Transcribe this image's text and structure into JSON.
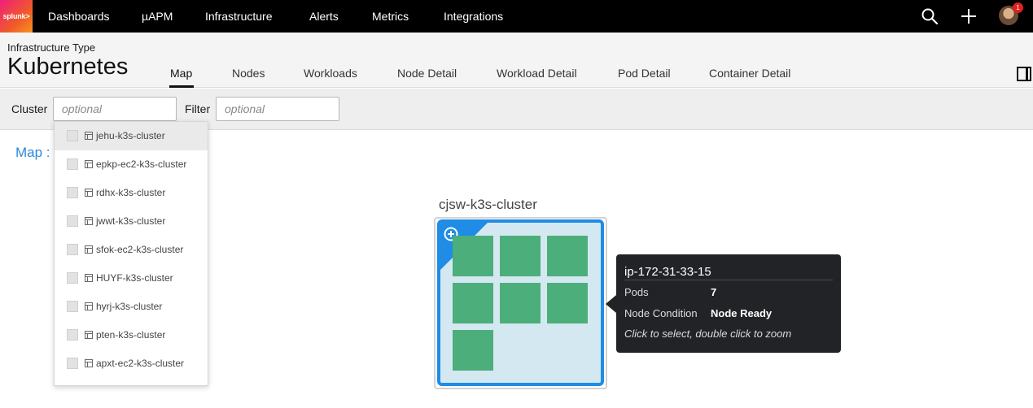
{
  "nav": {
    "logo": "splunk>",
    "items": [
      {
        "label": "Dashboards"
      },
      {
        "label": "µAPM"
      },
      {
        "label": "Infrastructure"
      },
      {
        "label": "Alerts"
      },
      {
        "label": "Metrics"
      },
      {
        "label": "Integrations"
      }
    ],
    "icons": [
      "search-icon",
      "plus-icon",
      "avatar"
    ],
    "notification_count": "1",
    "badge_color": "#e0201c"
  },
  "header": {
    "infra_type_label": "Infrastructure Type",
    "title": "Kubernetes",
    "tabs": [
      {
        "label": "Map",
        "active": true
      },
      {
        "label": "Nodes"
      },
      {
        "label": "Workloads"
      },
      {
        "label": "Node Detail"
      },
      {
        "label": "Workload Detail"
      },
      {
        "label": "Pod Detail"
      },
      {
        "label": "Container Detail"
      }
    ]
  },
  "filters": {
    "cluster_label": "Cluster",
    "cluster_placeholder": "optional",
    "filter_label": "Filter",
    "filter_placeholder": "optional"
  },
  "map": {
    "breadcrumb": "Map :",
    "cluster_name": "cjsw-k3s-cluster",
    "pods_shown": 7,
    "node_color": "#1f8ce6",
    "pod_color": "#4cae7b"
  },
  "cluster_dropdown": {
    "options": [
      {
        "label": "jehu-k3s-cluster",
        "hover": true
      },
      {
        "label": "epkp-ec2-k3s-cluster"
      },
      {
        "label": "rdhx-k3s-cluster"
      },
      {
        "label": "jwwt-k3s-cluster"
      },
      {
        "label": "sfok-ec2-k3s-cluster"
      },
      {
        "label": "HUYF-k3s-cluster"
      },
      {
        "label": "hyrj-k3s-cluster"
      },
      {
        "label": "pten-k3s-cluster"
      },
      {
        "label": "apxt-ec2-k3s-cluster"
      }
    ]
  },
  "tooltip": {
    "title": "ip-172-31-33-15",
    "pods_label": "Pods",
    "pods_value": "7",
    "condition_label": "Node Condition",
    "condition_value": "Node Ready",
    "hint": "Click to select, double click to zoom"
  }
}
